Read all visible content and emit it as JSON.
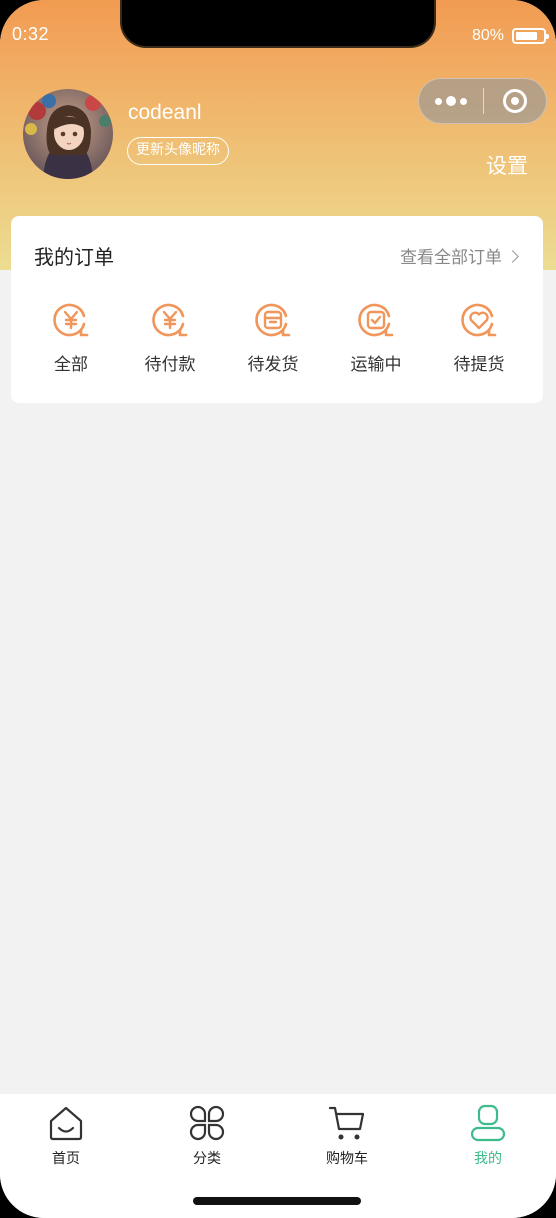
{
  "status_bar": {
    "time": "0:32",
    "battery": "80%"
  },
  "profile": {
    "username": "codeanl",
    "update_button": "更新头像昵称",
    "settings": "设置"
  },
  "orders": {
    "title": "我的订单",
    "view_all": "查看全部订单",
    "items": [
      {
        "label": "全部",
        "icon": "yen-icon"
      },
      {
        "label": "待付款",
        "icon": "yen-icon"
      },
      {
        "label": "待发货",
        "icon": "box-icon"
      },
      {
        "label": "运输中",
        "icon": "check-box-icon"
      },
      {
        "label": "待提货",
        "icon": "heart-icon"
      }
    ]
  },
  "tabbar": {
    "items": [
      {
        "label": "首页",
        "icon": "home-icon"
      },
      {
        "label": "分类",
        "icon": "category-icon"
      },
      {
        "label": "购物车",
        "icon": "cart-icon"
      },
      {
        "label": "我的",
        "icon": "user-icon",
        "active": true
      }
    ]
  },
  "colors": {
    "accent": "#f0965a",
    "tab_active": "#3dbb8a",
    "header_top": "#f29b52",
    "header_bottom": "#ecdd92"
  }
}
